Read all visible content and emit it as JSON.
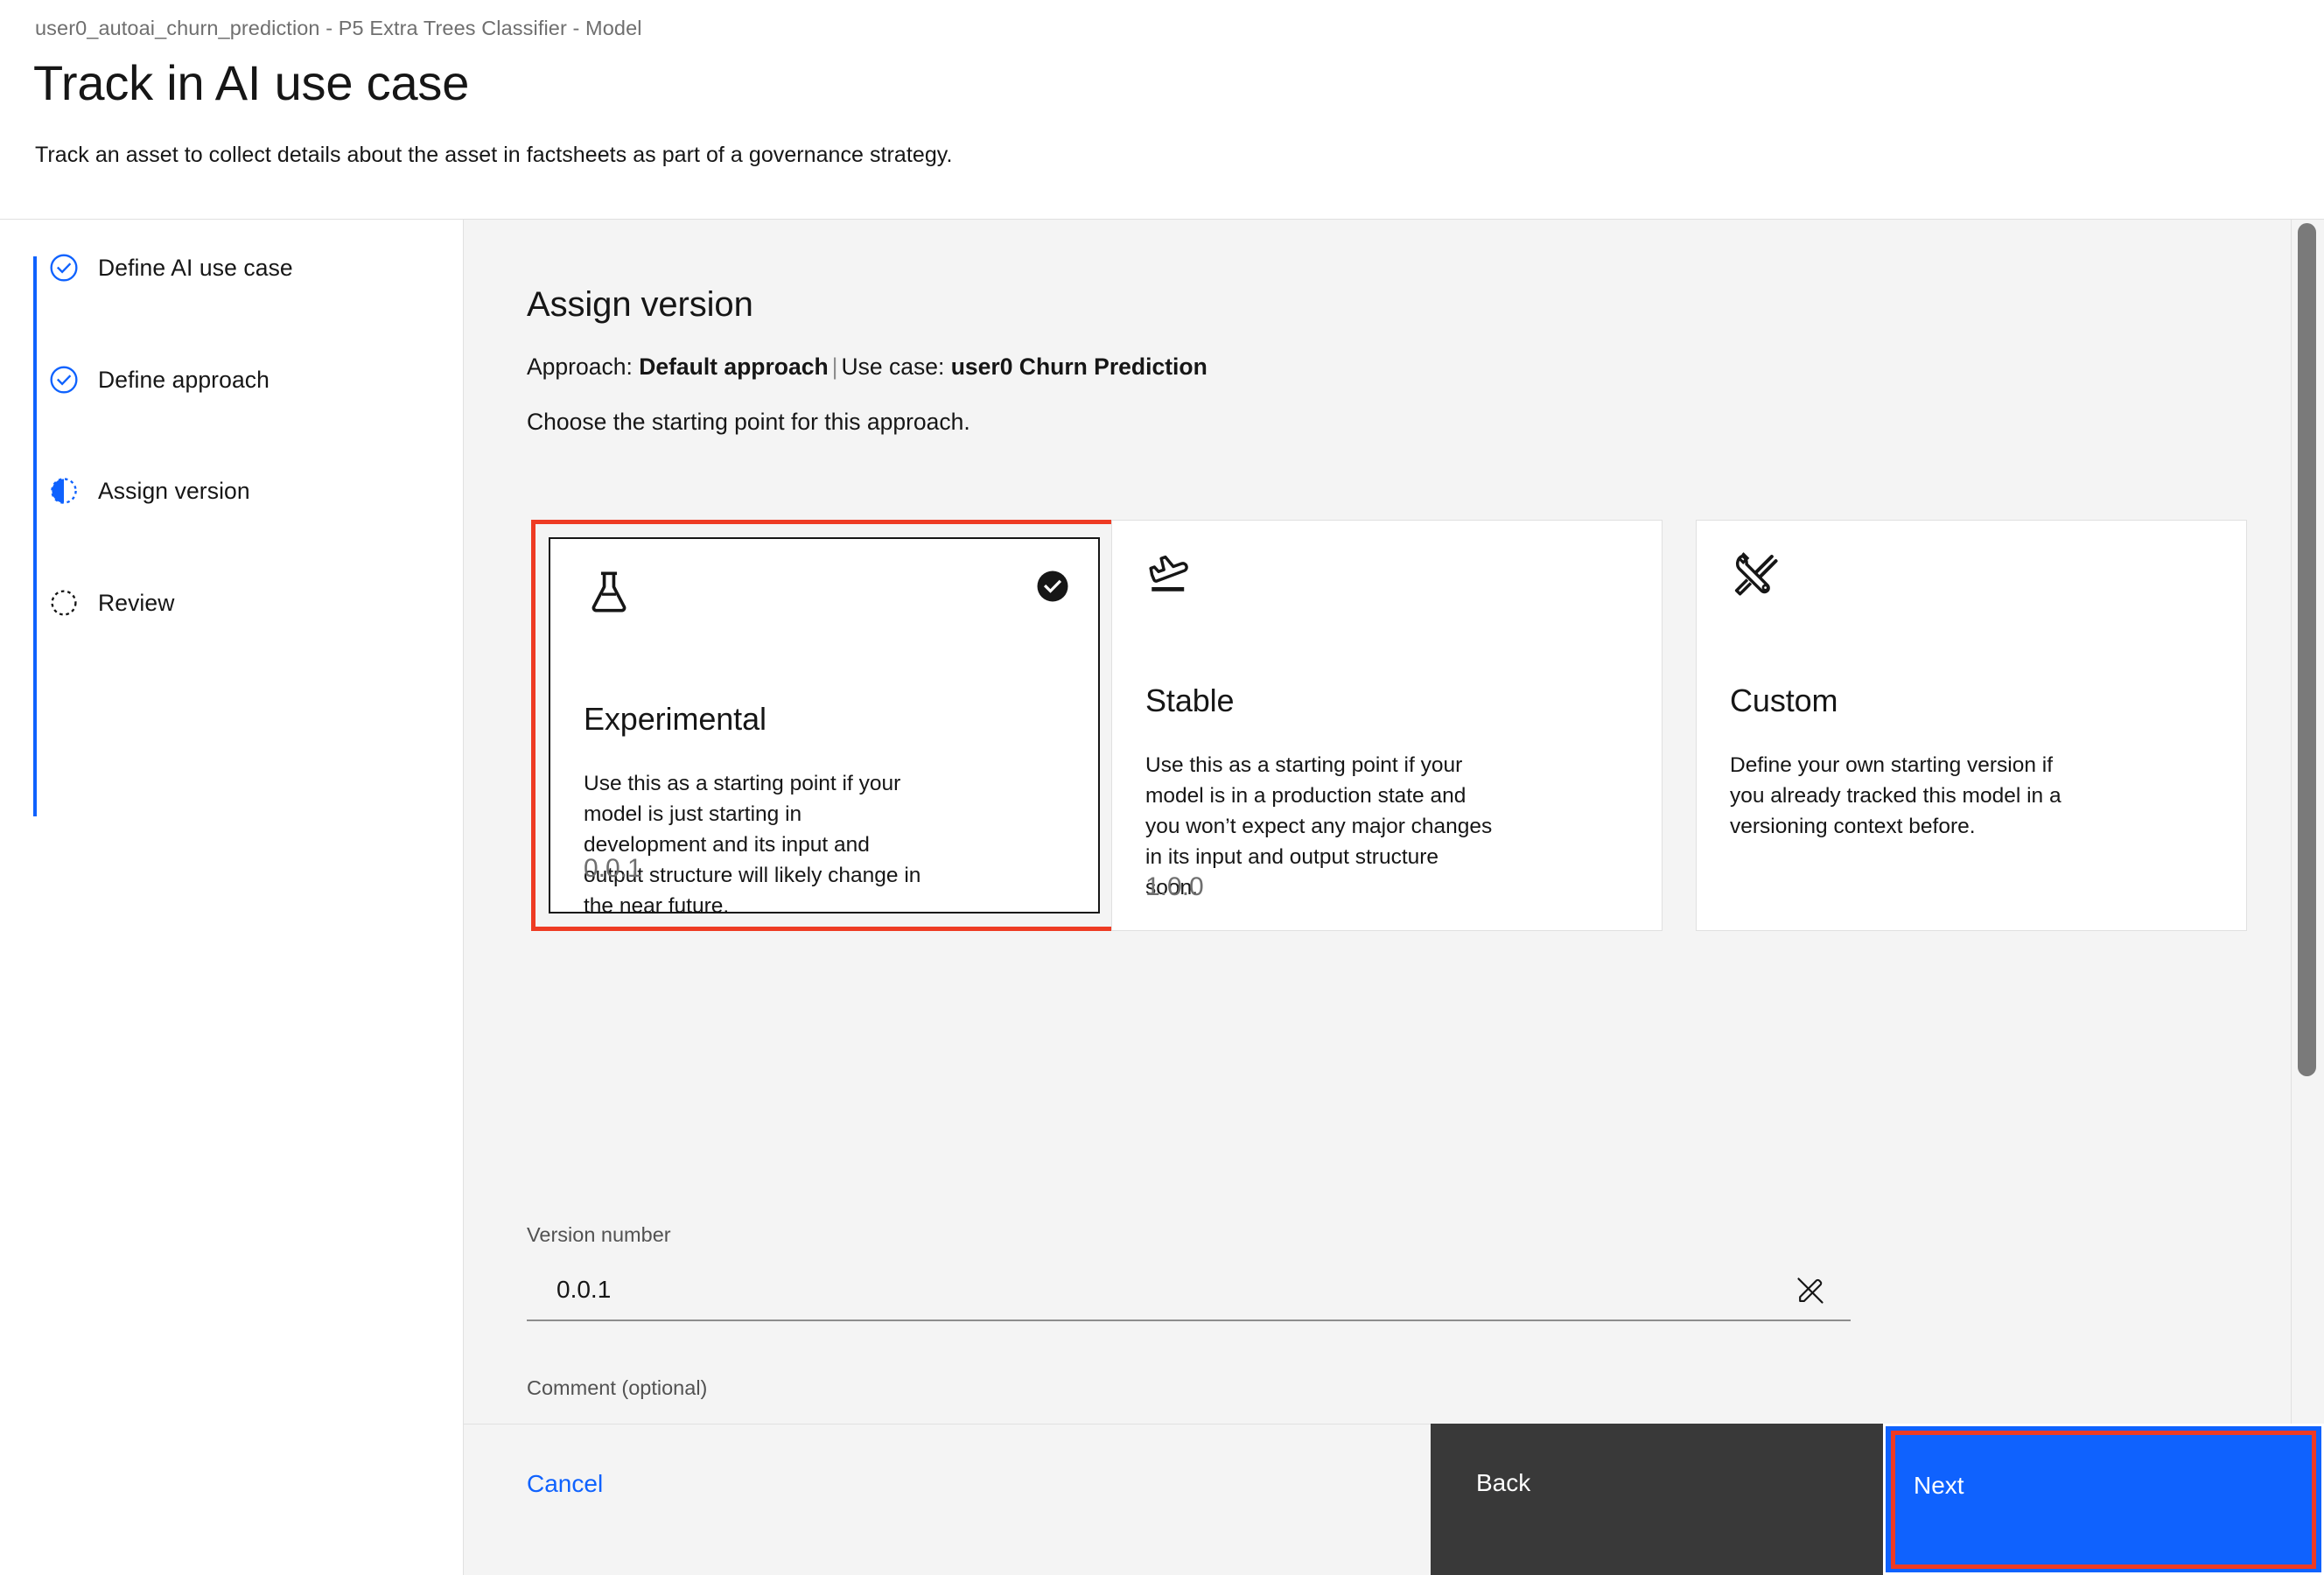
{
  "header": {
    "breadcrumb": "user0_autoai_churn_prediction - P5 Extra Trees Classifier - Model",
    "title": "Track in AI use case",
    "subtitle": "Track an asset to collect details about the asset in factsheets as part of a governance strategy."
  },
  "sidebar": {
    "steps": [
      {
        "label": "Define AI use case",
        "state": "complete",
        "icon": "check-circle-icon"
      },
      {
        "label": "Define approach",
        "state": "complete",
        "icon": "check-circle-icon"
      },
      {
        "label": "Assign version",
        "state": "current",
        "icon": "half-circle-icon"
      },
      {
        "label": "Review",
        "state": "incomplete",
        "icon": "dashed-circle-icon"
      }
    ]
  },
  "main": {
    "section_title": "Assign version",
    "meta": {
      "approach_label": "Approach:",
      "approach_value": "Default approach",
      "separator": "|",
      "usecase_label": "Use case:",
      "usecase_value": "user0 Churn Prediction"
    },
    "instruction": "Choose the starting point for this approach.",
    "cards": [
      {
        "title": "Experimental",
        "description": "Use this as a starting point if your model is just starting in development and its input and output structure will likely change in the near future.",
        "version": "0.0.1",
        "icon": "flask-icon",
        "selected": true
      },
      {
        "title": "Stable",
        "description": "Use this as a starting point if your model is in a production state and you won’t expect any major changes in its input and output structure soon.",
        "version": "1.0.0",
        "icon": "airplane-takeoff-icon",
        "selected": false
      },
      {
        "title": "Custom",
        "description": "Define your own starting version if you already tracked this model in a versioning context before.",
        "version": "",
        "icon": "tools-icon",
        "selected": false
      }
    ],
    "form": {
      "version_label": "Version number",
      "version_value": "0.0.1",
      "version_edit_icon": "edit-off-icon",
      "comment_label": "Comment (optional)"
    }
  },
  "footer": {
    "cancel_label": "Cancel",
    "back_label": "Back",
    "next_label": "Next"
  },
  "colors": {
    "accent_blue": "#0f62fe",
    "highlight_red": "#ee3b23",
    "dark": "#161616",
    "back_button": "#393939",
    "panel_bg": "#f4f4f4"
  }
}
